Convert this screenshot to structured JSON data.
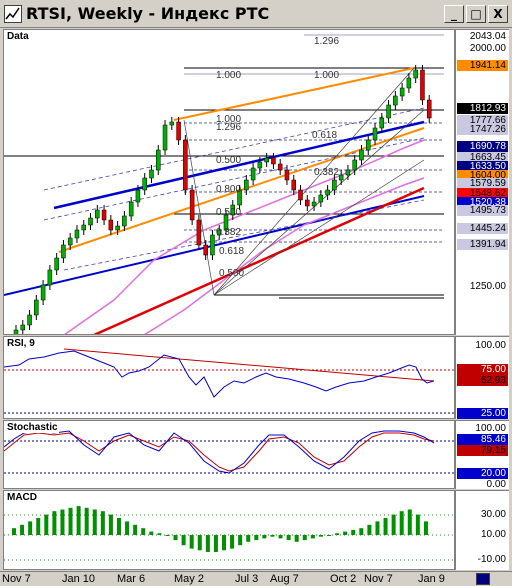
{
  "window": {
    "title": "RTSI, Weekly - Индекс РТС",
    "buttons": [
      "_",
      "□",
      "X"
    ]
  },
  "panes": {
    "price": {
      "label": "Data",
      "axis_ticks": [
        "2043.04",
        "2000.00",
        "1250.00"
      ],
      "price_tags": [
        {
          "text": "1941.14",
          "bg": "#ff8c00",
          "fg": "#000000"
        },
        {
          "text": "1812.93",
          "bg": "#000000",
          "fg": "#ffffff"
        },
        {
          "text": "1777.66",
          "bg": "#c8c8e0",
          "fg": "#000000"
        },
        {
          "text": "1747.26",
          "bg": "#c8c8e0",
          "fg": "#000000"
        },
        {
          "text": "1690.78",
          "bg": "#000080",
          "fg": "#ffffff"
        },
        {
          "text": "1663.45",
          "bg": "#c8c8e0",
          "fg": "#000000"
        },
        {
          "text": "1633.50",
          "bg": "#000080",
          "fg": "#ffffff"
        },
        {
          "text": "1604.00",
          "bg": "#ff8c00",
          "fg": "#000000"
        },
        {
          "text": "1579.59",
          "bg": "#c8c8e0",
          "fg": "#000000"
        },
        {
          "text": "1548.62",
          "bg": "#ff0000",
          "fg": "#000000"
        },
        {
          "text": "1520.38",
          "bg": "#0000cd",
          "fg": "#ffffff"
        },
        {
          "text": "1495.73",
          "bg": "#c8c8e0",
          "fg": "#000000"
        },
        {
          "text": "1445.24",
          "bg": "#c8c8e0",
          "fg": "#000000"
        },
        {
          "text": "1391.94",
          "bg": "#c8c8e0",
          "fg": "#000000"
        }
      ],
      "fib_labels": [
        "1.296",
        "1.000",
        "1.000",
        "1.000",
        "1.296",
        "0.618",
        "0.500",
        "0.382",
        "0.800",
        "0.500",
        "0.382",
        "0.618",
        "0.500"
      ]
    },
    "rsi": {
      "label": "RSI, 9",
      "axis_ticks": [
        "100.00",
        "25.00"
      ],
      "tags": [
        {
          "text": "75.00",
          "bg": "#c00000",
          "fg": "#ffffff"
        },
        {
          "text": "62.93",
          "bg": "#c00000",
          "fg": "#000000"
        }
      ]
    },
    "stochastic": {
      "label": "Stochastic",
      "axis_ticks": [
        "100.00",
        "0.00"
      ],
      "tags": [
        {
          "text": "85.46",
          "bg": "#0000cd",
          "fg": "#ffffff"
        },
        {
          "text": "79.15",
          "bg": "#c00000",
          "fg": "#000000"
        },
        {
          "text": "20.00",
          "bg": "#0000cd",
          "fg": "#ffffff"
        }
      ]
    },
    "macd": {
      "label": "MACD",
      "axis_ticks": [
        "30.00",
        "10.00",
        "-10.00"
      ]
    }
  },
  "dates": [
    "Nov 7",
    "Jan 10",
    "Mar 6",
    "May 2",
    "Jul 3",
    "Aug 7",
    "Oct 2",
    "Nov 7",
    "Jan 9"
  ]
}
